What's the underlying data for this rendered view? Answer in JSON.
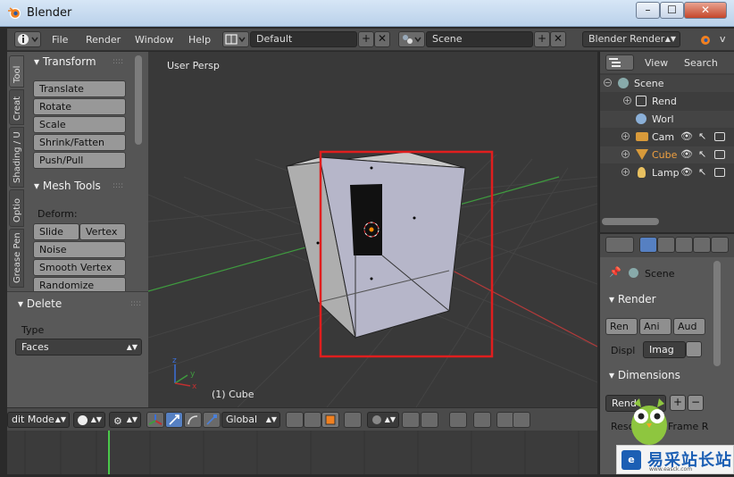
{
  "window": {
    "title": "Blender",
    "minimize": "–",
    "maximize": "☐",
    "close": "✕"
  },
  "header": {
    "menus": [
      "File",
      "Render",
      "Window",
      "Help"
    ],
    "screen_layout": "Default",
    "scene": "Scene",
    "render_engine": "Blender Render",
    "version_stub": "v"
  },
  "toolshelf": {
    "tabs": [
      "Tool",
      "Creat",
      "Shading / U",
      "Optio",
      "Grease Pen"
    ],
    "transform": {
      "title": "Transform",
      "buttons": [
        "Translate",
        "Rotate",
        "Scale",
        "Shrink/Fatten",
        "Push/Pull"
      ]
    },
    "mesh_tools": {
      "title": "Mesh Tools",
      "deform_label": "Deform:",
      "slide_edge": "Slide Ed",
      "vertex": "Vertex",
      "buttons": [
        "Noise",
        "Smooth Vertex",
        "Randomize"
      ]
    }
  },
  "operator_panel": {
    "title": "Delete",
    "type_label": "Type",
    "type_value": "Faces"
  },
  "viewport": {
    "view_name": "User Persp",
    "object_label": "(1) Cube"
  },
  "viewport_header": {
    "mode": "dit Mode",
    "orientation": "Global"
  },
  "outliner": {
    "view_menu": "View",
    "search_menu": "Search",
    "items": [
      {
        "name": "Scene",
        "icon": "scene-icon"
      },
      {
        "name": "Rend",
        "icon": "render-layers-icon"
      },
      {
        "name": "Worl",
        "icon": "world-icon"
      },
      {
        "name": "Cam",
        "icon": "camera-icon"
      },
      {
        "name": "Cube",
        "icon": "mesh-icon"
      },
      {
        "name": "Lamp",
        "icon": "lamp-icon"
      }
    ]
  },
  "properties": {
    "context": "Scene",
    "render_panel": "Render",
    "render_btn": "Ren",
    "anim_btn": "Ani",
    "audio_btn": "Aud",
    "display_label": "Displ",
    "display_value": "Imag",
    "dimensions_panel": "Dimensions",
    "preset_value": "Rend",
    "resolution_label": "Resol",
    "frame_rate_label": "Frame R"
  },
  "watermark": {
    "text": "易采站长站",
    "sub": "www.easck.com"
  },
  "colors": {
    "selection_box": "#e01e1e",
    "accent_blue": "#5680c2",
    "cube_face": "#b9b9c8"
  }
}
